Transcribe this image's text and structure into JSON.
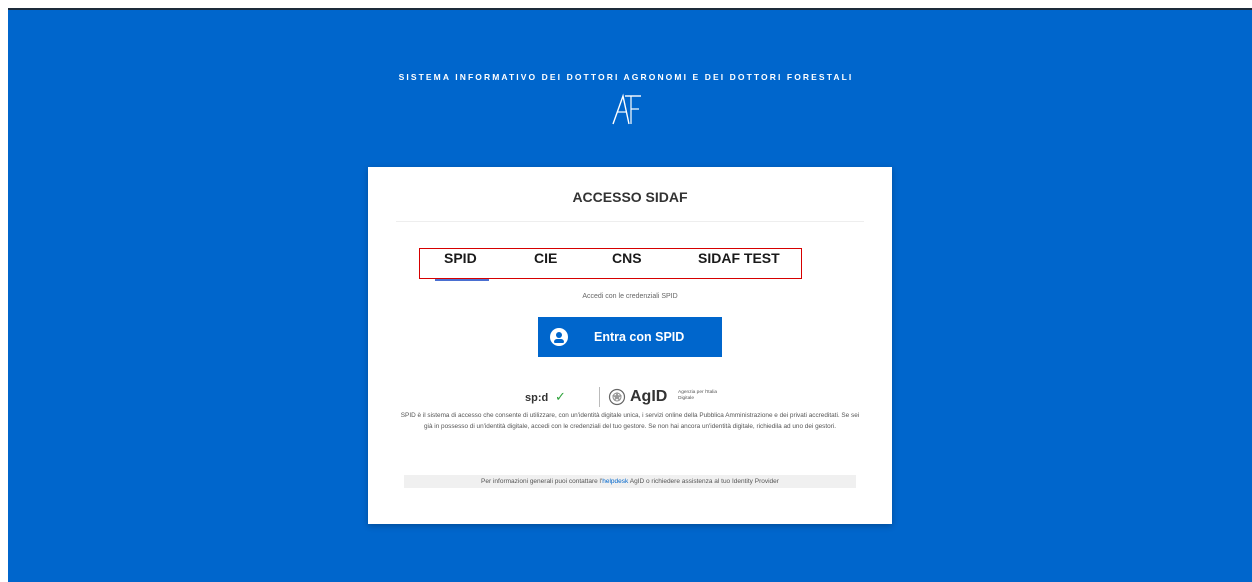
{
  "header": {
    "system_title": "SISTEMA INFORMATIVO DEI DOTTORI AGRONOMI E DEI DOTTORI FORESTALI",
    "logo_icon": "af-monogram-logo"
  },
  "card": {
    "title": "ACCESSO SIDAF",
    "tabs": [
      {
        "label": "SPID",
        "active": true
      },
      {
        "label": "CIE",
        "active": false
      },
      {
        "label": "CNS",
        "active": false
      },
      {
        "label": "SIDAF TEST",
        "active": false
      }
    ],
    "hint": "Accedi con le credenziali SPID",
    "spid_button": {
      "label": "Entra con SPID",
      "icon": "user-circle-icon"
    },
    "logos": {
      "spid": "sp:d",
      "agid": "AgID",
      "agid_sub": "Agenzia per l'Italia Digitale"
    },
    "description": "SPID è il sistema di accesso che consente di utilizzare, con un'identità digitale unica, i servizi online della Pubblica Amministrazione e dei privati accreditati. Se sei già in possesso di un'identità digitale, accedi con le credenziali del tuo gestore. Se non hai ancora un'identità digitale, richiedila ad uno dei gestori.",
    "info": {
      "prefix": "Per informazioni generali puoi contattare l'",
      "link": "helpdesk",
      "suffix": " AgID o richiedere assistenza al tuo Identity Provider"
    }
  },
  "colors": {
    "background": "#0066cc",
    "button": "#0066cc",
    "highlight_border": "#d60000",
    "tab_underline": "#4a6fd1"
  }
}
